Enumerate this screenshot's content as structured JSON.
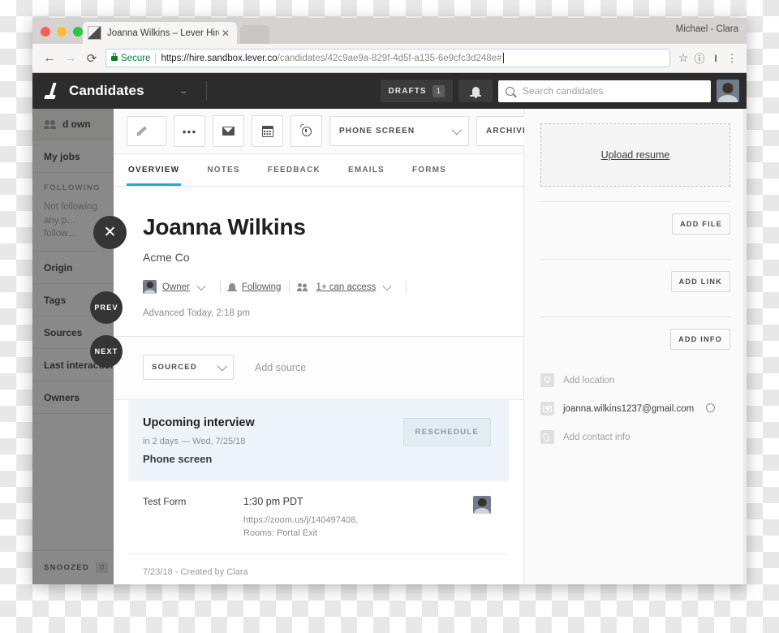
{
  "browser": {
    "tab_title": "Joanna Wilkins – Lever Hire",
    "tab_close": "✕",
    "window_user": "Michael - Clara",
    "back_icon": "←",
    "forward_icon": "→",
    "reload_icon": "⟳",
    "secure_label": "Secure",
    "url_domain": "https://hire.sandbox.lever.co",
    "url_path": "/candidates/42c9ae9a-829f-4d5f-a135-6e9cfc3d248e#",
    "star_icon": "☆",
    "info_icon": "ⓘ",
    "profile_icon": "I",
    "menu_icon": "⋮"
  },
  "appbar": {
    "title": "Candidates",
    "chevron": "⌄",
    "drafts_label": "DRAFTS",
    "drafts_count": "1",
    "search_placeholder": "Search candidates",
    "search_value": ""
  },
  "leftnav": {
    "top_item": "d own",
    "items": [
      {
        "label": "My jobs"
      },
      {
        "label": "Origin"
      },
      {
        "label": "Tags"
      },
      {
        "label": "Sources"
      },
      {
        "label": "Last interaction"
      },
      {
        "label": "Owners"
      }
    ],
    "following_header": "FOLLOWING",
    "following_empty": "Not following any p… follow…",
    "snoozed_label": "SNOOZED",
    "snoozed_count": "0"
  },
  "overlay": {
    "close": "✕",
    "prev": "PREV",
    "next": "NEXT"
  },
  "toolbar": {
    "note_placeholder": "Add note",
    "note_value": "",
    "more_label": "•••",
    "stage_label": "PHONE SCREEN",
    "archive_label": "ARCHIVE"
  },
  "tabs": [
    {
      "label": "OVERVIEW",
      "active": true
    },
    {
      "label": "NOTES",
      "active": false
    },
    {
      "label": "FEEDBACK",
      "active": false
    },
    {
      "label": "EMAILS",
      "active": false
    },
    {
      "label": "FORMS",
      "active": false
    }
  ],
  "profile": {
    "name": "Joanna Wilkins",
    "company": "Acme Co",
    "owner_label": "Owner",
    "following_label": "Following",
    "access_label": "1+ can access",
    "advanced_line": "Advanced Today, 2:18 pm"
  },
  "source": {
    "stage_value": "SOURCED",
    "add_source_label": "Add source"
  },
  "interview": {
    "heading": "Upcoming interview",
    "when": "in 2 days — Wed, 7/25/18",
    "type": "Phone screen",
    "reschedule_label": "RESCHEDULE",
    "form_name": "Test Form",
    "time": "1:30 pm PDT",
    "location_line1": "https://zoom.us/j/140497408,",
    "location_line2": "Rooms: Portal Exit",
    "created_line": "7/23/18 - Created by Clara"
  },
  "rightpanel": {
    "upload_resume": "Upload resume",
    "add_file": "ADD FILE",
    "add_link": "ADD LINK",
    "add_info": "ADD INFO",
    "contacts": [
      {
        "text": "Add location",
        "filled": false
      },
      {
        "text": "joanna.wilkins1237@gmail.com",
        "filled": true
      },
      {
        "text": "Add contact info",
        "filled": false
      }
    ]
  },
  "colors": {
    "accent_blue": "#1eaade",
    "appbar_dark": "#2c2c2c",
    "card_blue": "#eef5fa",
    "secure_green": "#0a7f2e"
  }
}
